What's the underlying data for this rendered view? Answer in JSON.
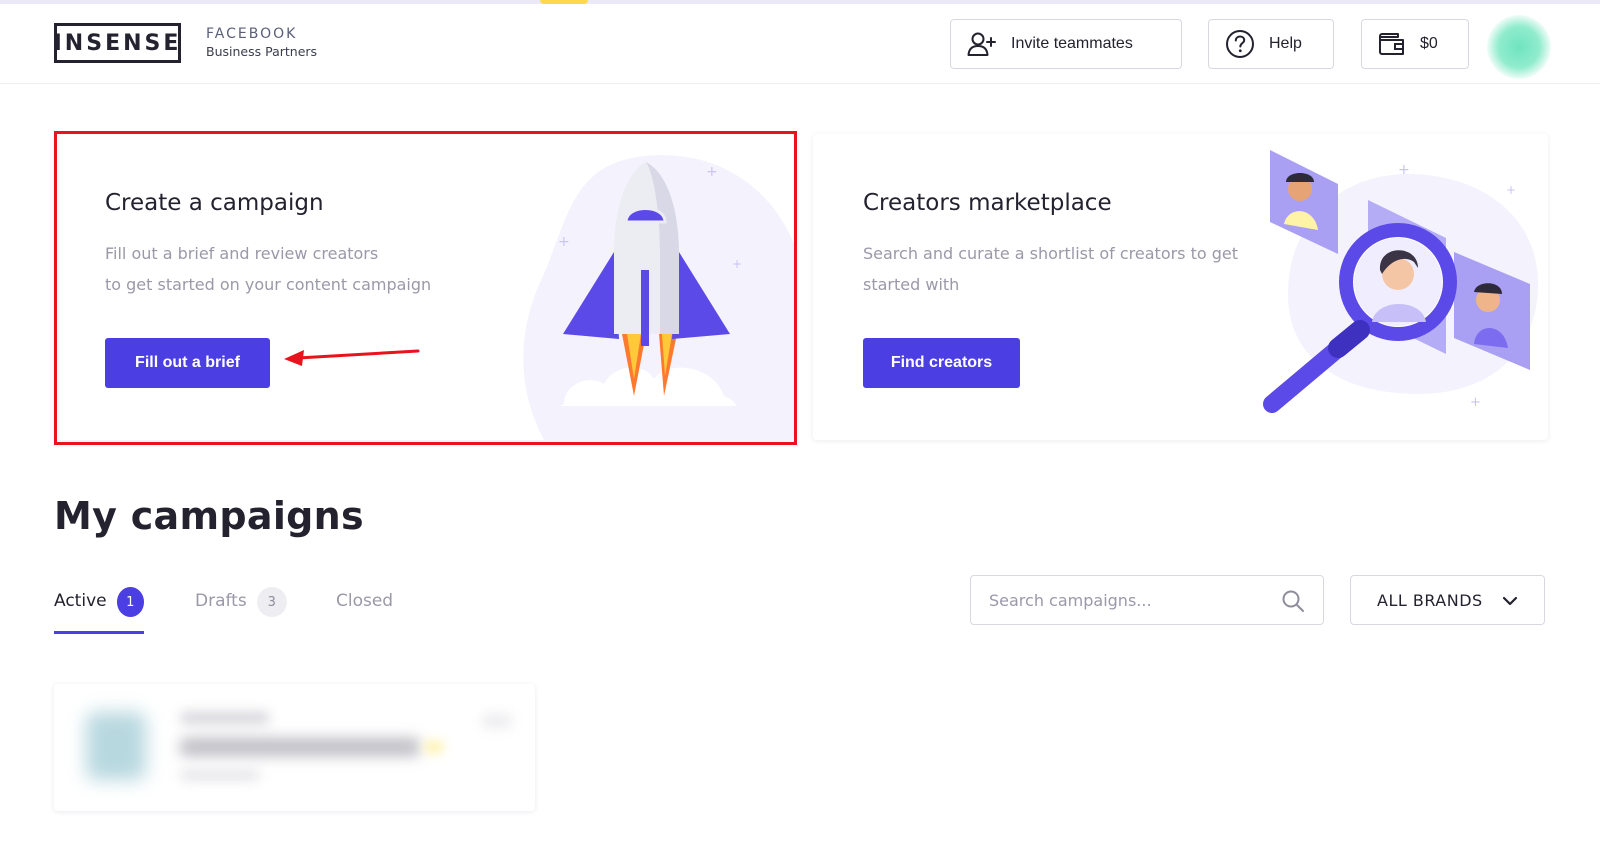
{
  "header": {
    "logo": "INSENSE",
    "partner_title": "FACEBOOK",
    "partner_subtitle": "Business Partners",
    "invite_label": "Invite teammates",
    "help_label": "Help",
    "balance": "$0"
  },
  "cards": {
    "create": {
      "title": "Create a campaign",
      "desc_line1": "Fill out a brief and review creators",
      "desc_line2": "to get started on your content campaign",
      "button": "Fill out a brief"
    },
    "market": {
      "title": "Creators marketplace",
      "desc_line1": "Search and curate a shortlist of creators to get",
      "desc_line2": "started with",
      "button": "Find creators"
    }
  },
  "campaigns": {
    "title": "My campaigns",
    "tabs": [
      {
        "label": "Active",
        "count": "1"
      },
      {
        "label": "Drafts",
        "count": "3"
      },
      {
        "label": "Closed"
      }
    ],
    "search_placeholder": "Search campaigns...",
    "brands_filter": "ALL BRANDS"
  },
  "colors": {
    "accent": "#4b3ee2",
    "highlight": "#e8131c",
    "text": "#24222e",
    "muted": "#9a99a8"
  }
}
